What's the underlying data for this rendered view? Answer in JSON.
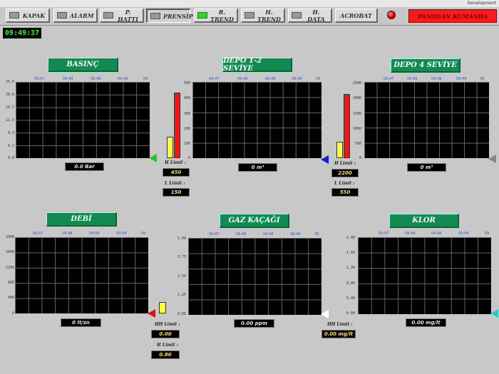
{
  "window": {
    "dev_label": "Development"
  },
  "nav": {
    "kapak": "KAPAK",
    "alarm": "ALARM",
    "p_hatti": "P. HATTI",
    "prensip": "PRENSİP",
    "r_trend": "R. TREND",
    "h_trend": "H. TREND",
    "h_data": "H. DATA",
    "acrobat": "ACROBAT",
    "panodan": "PANODAN KUMANDA"
  },
  "clock": "09:49:37",
  "time_ticks": [
    "09:47",
    "09:48",
    "09:48",
    "09:49",
    "09"
  ],
  "charts": {
    "basinc": {
      "title": "BASINÇ",
      "y_ticks": [
        "25.0",
        "20.8",
        "16.7",
        "12.5",
        "8.3",
        "4.2",
        "0.0"
      ],
      "value": "0.0 Bar",
      "marker_color": "#22cc22"
    },
    "depo12": {
      "title": "DEPO 1-2 SEVİYE",
      "y_ticks": [
        "500",
        "400",
        "300",
        "200",
        "100",
        "0"
      ],
      "value": "0 m³",
      "marker_color": "#1122cc",
      "h_limit_label": "H Limit :",
      "h_limit_value": "450",
      "l_limit_label": "L Limit :",
      "l_limit_value": "150"
    },
    "depo4": {
      "title": "DEPO 4 SEVİYE",
      "y_ticks": [
        "2500",
        "2000",
        "1500",
        "1000",
        "500",
        "0"
      ],
      "value": "0 m³",
      "marker_color": "#888888",
      "h_limit_label": "H Limit :",
      "h_limit_value": "2200",
      "l_limit_label": "L Limit :",
      "l_limit_value": "550"
    },
    "debi": {
      "title": "DEBİ",
      "y_ticks": [
        "2000",
        "1600",
        "1200",
        "800",
        "400",
        "0"
      ],
      "value": "0 lt/sn",
      "marker_color": "#dd1111"
    },
    "gaz": {
      "title": "GAZ KAÇAĞI",
      "y_ticks": [
        "5.00",
        "3.75",
        "2.50",
        "1.25",
        "0.00"
      ],
      "value": "0.00 ppm",
      "marker_color": "#ffffff",
      "hh_limit_label": "HH Limit :",
      "hh_limit_value": "0.00",
      "h_limit_label": "H Limit :",
      "h_limit_value": "0.80"
    },
    "klor": {
      "title": "KLOR",
      "y_ticks": [
        "2.00",
        "1.60",
        "1.20",
        "0.80",
        "0.40",
        "0.00"
      ],
      "value": "0.00 mg/lt",
      "marker_color": "#22cccc",
      "hh_limit_label": "HH Limit :",
      "hh_limit_value": "0.00 mg/lt"
    }
  }
}
